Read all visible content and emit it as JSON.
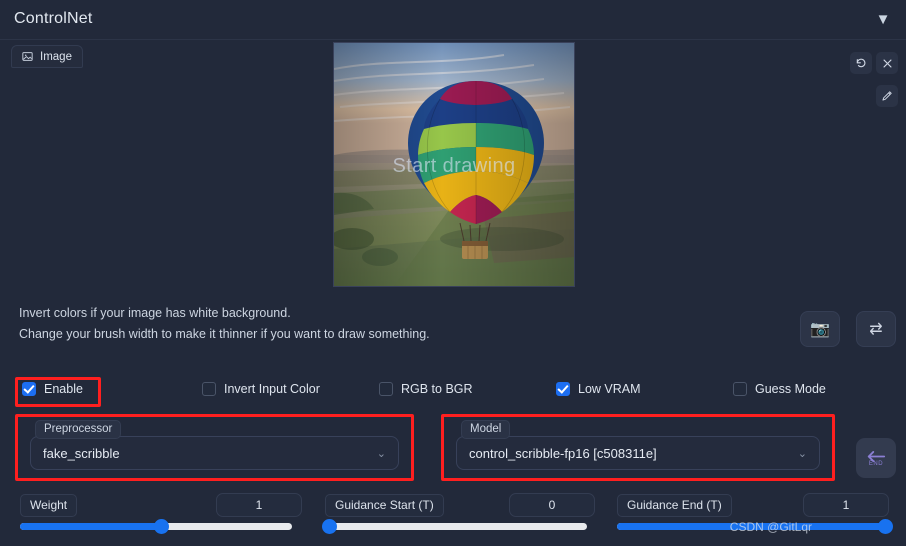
{
  "header": {
    "title": "ControlNet",
    "collapse_icon": "caret-down-icon",
    "collapse_glyph": "▼"
  },
  "tabs": [
    {
      "label": "Image",
      "icon": "image-icon"
    }
  ],
  "preview": {
    "overlay_text": "Start drawing",
    "description": "hot-air-balloon-over-fields-at-sunrise",
    "tools": [
      {
        "name": "undo-icon",
        "glyph": "↺"
      },
      {
        "name": "close-icon",
        "glyph": "✕"
      },
      {
        "name": "pen-icon",
        "glyph": "✎"
      }
    ]
  },
  "hints": {
    "line1": "Invert colors if your image has white background.",
    "line2": "Change your brush width to make it thinner if you want to draw something."
  },
  "actions": [
    {
      "name": "camera-button",
      "glyph": "📷"
    },
    {
      "name": "swap-button",
      "glyph": "⇄"
    }
  ],
  "checkboxes": [
    {
      "label": "Enable",
      "checked": true
    },
    {
      "label": "Invert Input Color",
      "checked": false
    },
    {
      "label": "RGB to BGR",
      "checked": false
    },
    {
      "label": "Low VRAM",
      "checked": true
    },
    {
      "label": "Guess Mode",
      "checked": false
    }
  ],
  "dropdowns": {
    "preprocessor": {
      "label": "Preprocessor",
      "value": "fake_scribble",
      "caret": "⌄"
    },
    "model": {
      "label": "Model",
      "value": "control_scribble-fp16 [c508311e]",
      "caret": "⌄"
    }
  },
  "end_button": {
    "name": "end-arrow-button",
    "label": "END",
    "glyph": "⬅"
  },
  "sliders": [
    {
      "label": "Weight",
      "value": "1",
      "percent": 52
    },
    {
      "label": "Guidance Start (T)",
      "value": "0",
      "percent": 0
    },
    {
      "label": "Guidance End (T)",
      "value": "1",
      "percent": 100
    }
  ],
  "watermark": "CSDN @GitLqr",
  "colors": {
    "background": "#22293a",
    "accent_blue": "#1872f2",
    "annotation_red": "#ff1f1f",
    "track": "#e8eaed",
    "end_purple": "#8b7fd4"
  }
}
